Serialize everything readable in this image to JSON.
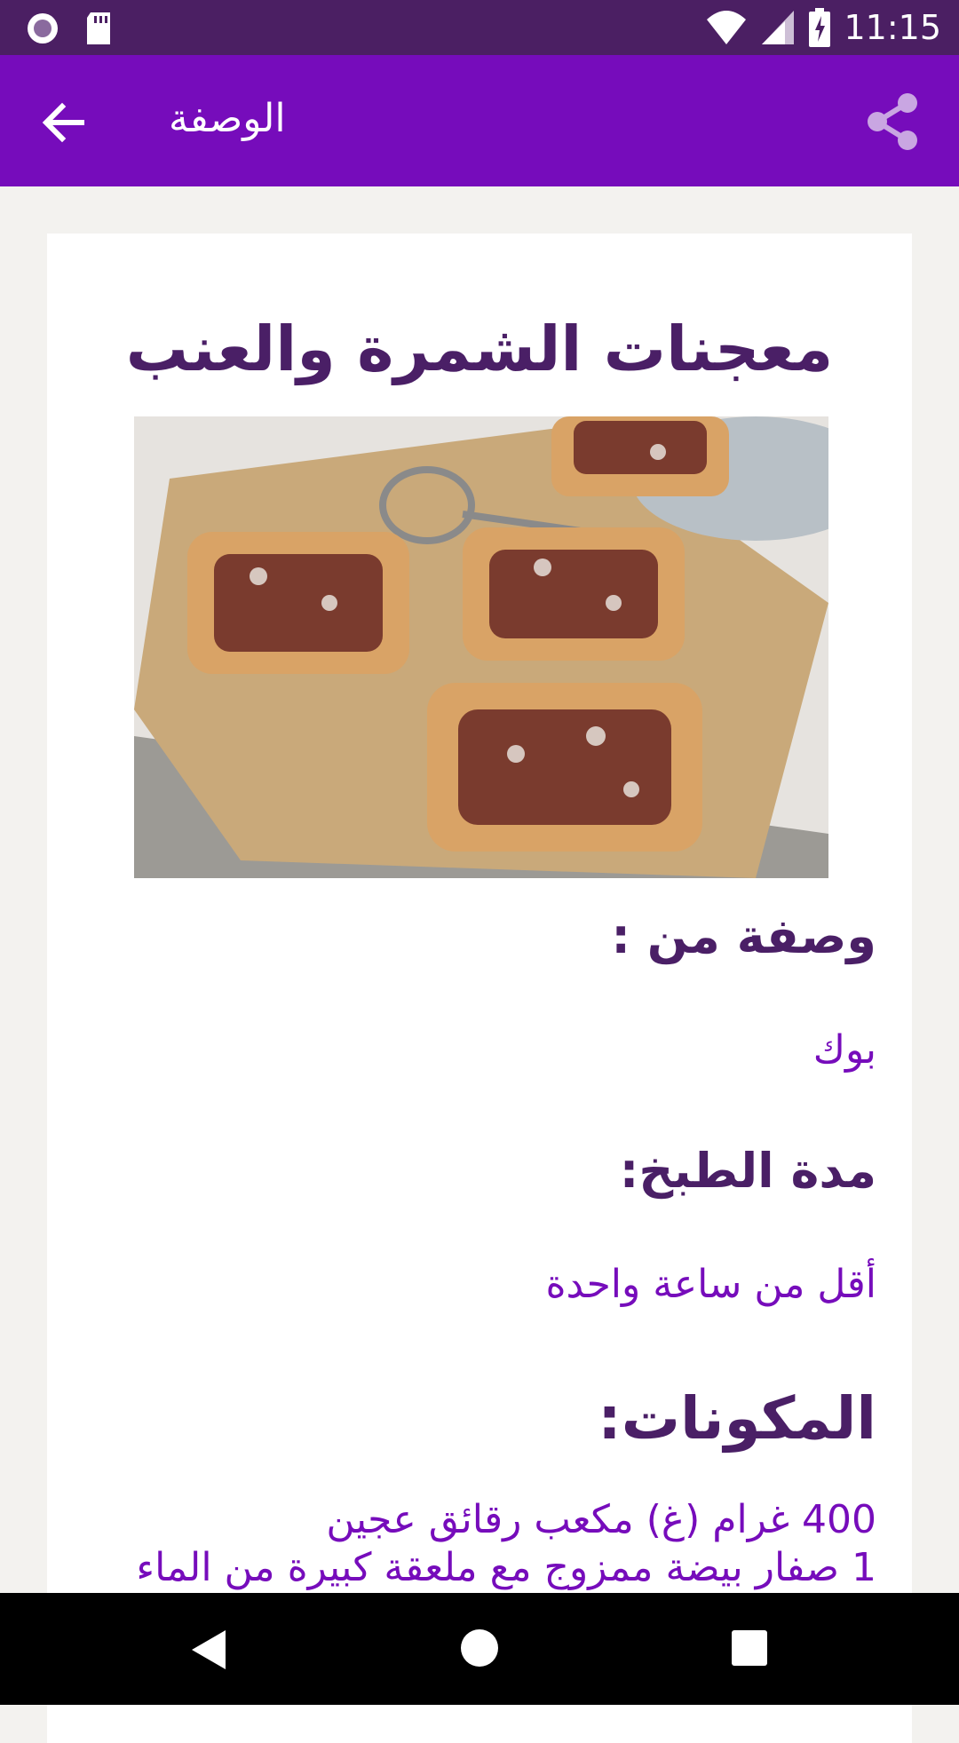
{
  "status_bar": {
    "time": "11:15",
    "icons": [
      "record-icon",
      "sd-card-icon",
      "wifi-icon",
      "signal-icon",
      "battery-charging-icon"
    ]
  },
  "app_bar": {
    "title": "الوصفة",
    "back_icon": "arrow-back-icon",
    "share_icon": "share-icon",
    "background": "#760cbb"
  },
  "recipe": {
    "title": "معجنات الشمرة والعنب",
    "image_desc_icon": "recipe-photo",
    "by_label": "وصفة من :",
    "by_value": "بوك",
    "cook_time_label": "مدة الطبخ:",
    "cook_time_value": "أقل من ساعة واحدة",
    "ingredients_label": "المكونات:",
    "ingredients": [
      "400 غرام (غ) مكعب رقائق عجين",
      "1 صفار بيضة ممزوج مع ملعقة كبيرة من الماء"
    ]
  },
  "nav_bar": {
    "icons": [
      "nav-back-icon",
      "nav-home-icon",
      "nav-recents-icon"
    ]
  },
  "colors": {
    "status_bar": "#4b1f63",
    "accent": "#760cbb",
    "heading": "#4a1f66"
  }
}
